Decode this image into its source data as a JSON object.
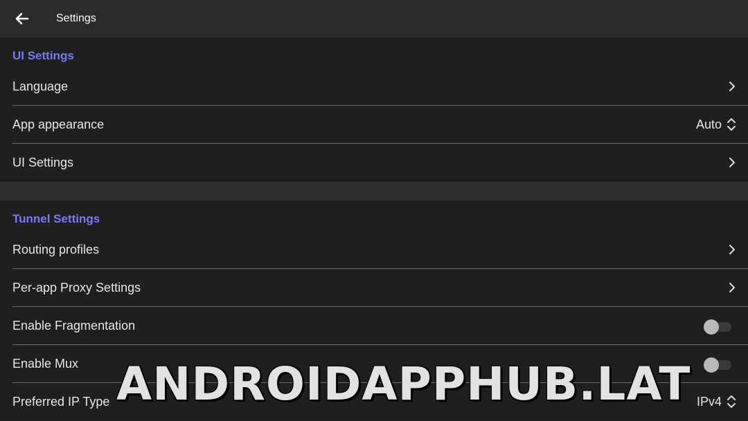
{
  "header": {
    "title": "Settings",
    "back_icon": "arrow-back-icon"
  },
  "sections": [
    {
      "title": "UI Settings",
      "rows": [
        {
          "label": "Language",
          "control": "chevron"
        },
        {
          "label": "App appearance",
          "control": "select",
          "value": "Auto"
        },
        {
          "label": "UI Settings",
          "control": "chevron"
        }
      ]
    },
    {
      "title": "Tunnel Settings",
      "rows": [
        {
          "label": "Routing profiles",
          "control": "chevron"
        },
        {
          "label": "Per-app Proxy Settings",
          "control": "chevron"
        },
        {
          "label": "Enable Fragmentation",
          "control": "toggle",
          "checked": false
        },
        {
          "label": "Enable Mux",
          "control": "toggle",
          "checked": false
        },
        {
          "label": "Preferred IP Type",
          "control": "select",
          "value": "IPv4"
        }
      ]
    }
  ],
  "watermark": "ANDROIDAPPHUB.LAT",
  "colors": {
    "accent": "#7a78ff",
    "background": "#1f1f1f",
    "topbar": "#2b2b2b"
  }
}
